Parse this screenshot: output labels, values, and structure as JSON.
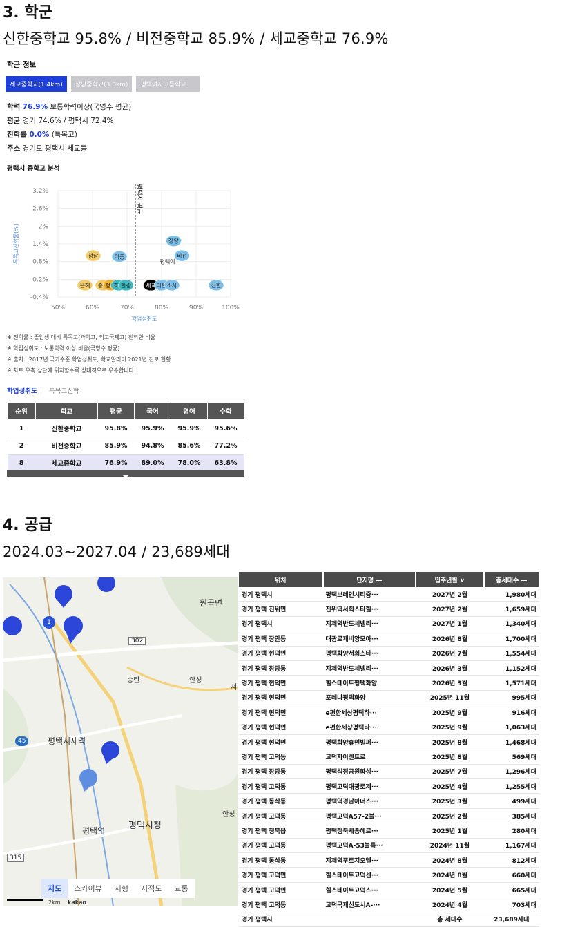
{
  "school": {
    "heading": "3. 학군",
    "summary": "신한중학교  95.8%  /  비전중학교  85.9%  /  세교중학교  76.9%",
    "info_title": "학군 정보",
    "tabs": [
      {
        "label": "세교중학교(1.4km)",
        "active": true
      },
      {
        "label": "장당중학교(3.3km)",
        "active": false
      },
      {
        "label": "평택여자고등학교",
        "active": false
      }
    ],
    "academic_label": "학력",
    "academic_value": "76.9%",
    "academic_desc": "보통학력이상(국영수 평균)",
    "avg_label": "평균",
    "avg_value": "경기 74.6% / 평택시 72.4%",
    "advance_label": "진학률",
    "advance_value": "0.0%",
    "advance_desc": "(특목고)",
    "address_label": "주소",
    "address_value": "경기도 평택시 세교동",
    "analysis_title": "평택시 중학교 분석",
    "notes": [
      "※ 진학률 : 졸업생 대비 특목고(과학고, 외고국제고) 진학한 비율",
      "※ 학업성취도 : 보통학력 이상 비율(국영수 평균)",
      "※ 출처 : 2017년 국가수준 학업성취도, 학교알리미 2021년 진로 현황",
      "※ 차트 우측 상단에 위치할수록 상대적으로 우수합니다."
    ],
    "toggle_active": "학업성취도",
    "toggle_sep": "|",
    "toggle_inactive": "특목고진학",
    "table_headers": [
      "순위",
      "학교",
      "평균",
      "국어",
      "영어",
      "수학"
    ],
    "table_rows": [
      [
        "1",
        "신한중학교",
        "95.8%",
        "95.9%",
        "95.9%",
        "95.6%"
      ],
      [
        "2",
        "비전중학교",
        "85.9%",
        "94.8%",
        "85.6%",
        "77.2%"
      ],
      [
        "8",
        "세교중학교",
        "76.9%",
        "89.0%",
        "78.0%",
        "63.8%"
      ]
    ]
  },
  "chart_data": {
    "type": "scatter",
    "xlabel": "학업성취도",
    "ylabel": "특목고진학률(%)",
    "xticks": [
      "50%",
      "60%",
      "70%",
      "80%",
      "90%",
      "100%"
    ],
    "yticks": [
      "3.2%",
      "2.6%",
      "2%",
      "1.4%",
      "0.8%",
      "0.2%",
      "-0.4%"
    ],
    "xlim": [
      50,
      100
    ],
    "ylim": [
      -0.4,
      3.2
    ],
    "avg_line_x": 72.4,
    "avg_line_label": "평택시 평균",
    "points": [
      {
        "name": "장당",
        "x": 83.5,
        "y": 1.5,
        "color": "#7ec0e8"
      },
      {
        "name": "비전",
        "x": 85.9,
        "y": 1.0,
        "color": "#7ec0e8"
      },
      {
        "name": "평택여",
        "x": 81.7,
        "y": 0.8,
        "color": "#ffffff"
      },
      {
        "name": "청담",
        "x": 60.2,
        "y": 1.0,
        "color": "#f2cc6a"
      },
      {
        "name": "이충",
        "x": 67.8,
        "y": 0.97,
        "color": "#7ec0e8"
      },
      {
        "name": "은혜",
        "x": 57.8,
        "y": 0.0,
        "color": "#f2cc6a"
      },
      {
        "name": "송탄",
        "x": 63.0,
        "y": 0.0,
        "color": "#f2cc6a"
      },
      {
        "name": "평택",
        "x": 65.2,
        "y": 0.0,
        "color": "#f2b030"
      },
      {
        "name": "효명",
        "x": 67.5,
        "y": 0.0,
        "color": "#3fb8c0"
      },
      {
        "name": "한광",
        "x": 69.7,
        "y": 0.0,
        "color": "#3fb8c0"
      },
      {
        "name": "세교",
        "x": 76.9,
        "y": 0.0,
        "color": "#000000"
      },
      {
        "name": "라온",
        "x": 80.0,
        "y": 0.0,
        "color": "#7ec0e8"
      },
      {
        "name": "소사",
        "x": 83.0,
        "y": 0.0,
        "color": "#7ec0e8"
      },
      {
        "name": "신한",
        "x": 95.8,
        "y": 0.0,
        "color": "#7ec0e8"
      }
    ]
  },
  "supply": {
    "heading": "4. 공급",
    "summary": "2024.03~2027.04  /  23,689세대",
    "headers": [
      "위치",
      "단지명 —",
      "입주년월 ∨",
      "총세대수 —"
    ],
    "rows": [
      [
        "경기 평택시",
        "평택브레인시티중···",
        "2027년 2월",
        "1,980세대"
      ],
      [
        "경기 평택 진위면",
        "진위역서희스타힐···",
        "2027년 2월",
        "1,659세대"
      ],
      [
        "경기 평택시",
        "지제역반도체밸리···",
        "2027년 1월",
        "1,340세대"
      ],
      [
        "경기 평택 장안동",
        "대광로제비앙모아···",
        "2026년 8월",
        "1,700세대"
      ],
      [
        "경기 평택 현덕면",
        "평택화양서희스타···",
        "2026년 7월",
        "1,554세대"
      ],
      [
        "경기 평택 장당동",
        "지제역반도체밸리···",
        "2026년 3월",
        "1,152세대"
      ],
      [
        "경기 평택 현덕면",
        "힐스테이트평택화양",
        "2026년 3월",
        "1,571세대"
      ],
      [
        "경기 평택 현덕면",
        "포레나평택화양",
        "2025년 11월",
        "995세대"
      ],
      [
        "경기 평택 현덕면",
        "e편한세상평택하···",
        "2025년 9월",
        "916세대"
      ],
      [
        "경기 평택 현덕면",
        "e편한세상평택라···",
        "2025년 9월",
        "1,063세대"
      ],
      [
        "경기 평택 현덕면",
        "평택화양휴먼빌퍼···",
        "2025년 8월",
        "1,468세대"
      ],
      [
        "경기 평택 고덕동",
        "고덕자이센트로",
        "2025년 8월",
        "569세대"
      ],
      [
        "경기 평택 장당동",
        "평택석정공원화성···",
        "2025년 7월",
        "1,296세대"
      ],
      [
        "경기 평택 고덕동",
        "평택고덕대광로제···",
        "2025년 4월",
        "1,255세대"
      ],
      [
        "경기 평택 동삭동",
        "평택역경남아너스···",
        "2025년 3월",
        "499세대"
      ],
      [
        "경기 평택 고덕동",
        "평택고덕A57-2블···",
        "2025년 2월",
        "385세대"
      ],
      [
        "경기 평택 청북읍",
        "평택청북세종헤르···",
        "2025년 1월",
        "280세대"
      ],
      [
        "경기 평택 고덕동",
        "평택고덕A-53블록···",
        "2024년 11월",
        "1,167세대"
      ],
      [
        "경기 평택 동삭동",
        "지제역푸르지오엘···",
        "2024년 8월",
        "812세대"
      ],
      [
        "경기 평택 고덕면",
        "힐스테이트고덕센···",
        "2024년 8월",
        "660세대"
      ],
      [
        "경기 평택 고덕면",
        "힐스테이트고덕스···",
        "2024년 5월",
        "665세대"
      ],
      [
        "경기 평택 고덕동",
        "고덕국제신도시A-···",
        "2024년 4월",
        "703세대"
      ]
    ],
    "total_location": "경기 평택시",
    "total_label": "총 세대수",
    "total_value": "23,689세대"
  },
  "map": {
    "labels": [
      {
        "text": "원곡면",
        "kind": "place"
      },
      {
        "text": "송탄",
        "kind": "ic"
      },
      {
        "text": "안성",
        "kind": "ic"
      },
      {
        "text": "평택지제역",
        "kind": "station"
      },
      {
        "text": "평택역",
        "kind": "station"
      },
      {
        "text": "평택시청",
        "kind": "place"
      },
      {
        "text": "안성",
        "kind": "ic2"
      },
      {
        "text": "302",
        "kind": "road"
      },
      {
        "text": "315",
        "kind": "road"
      },
      {
        "text": "45",
        "kind": "highway"
      },
      {
        "text": "서",
        "kind": "place2"
      }
    ],
    "tabs": [
      "지도",
      "스카이뷰",
      "지형",
      "지적도",
      "교통"
    ],
    "active_tab": "지도",
    "scale_text": "2km",
    "brand": "kakao",
    "cluster_count": "1"
  }
}
